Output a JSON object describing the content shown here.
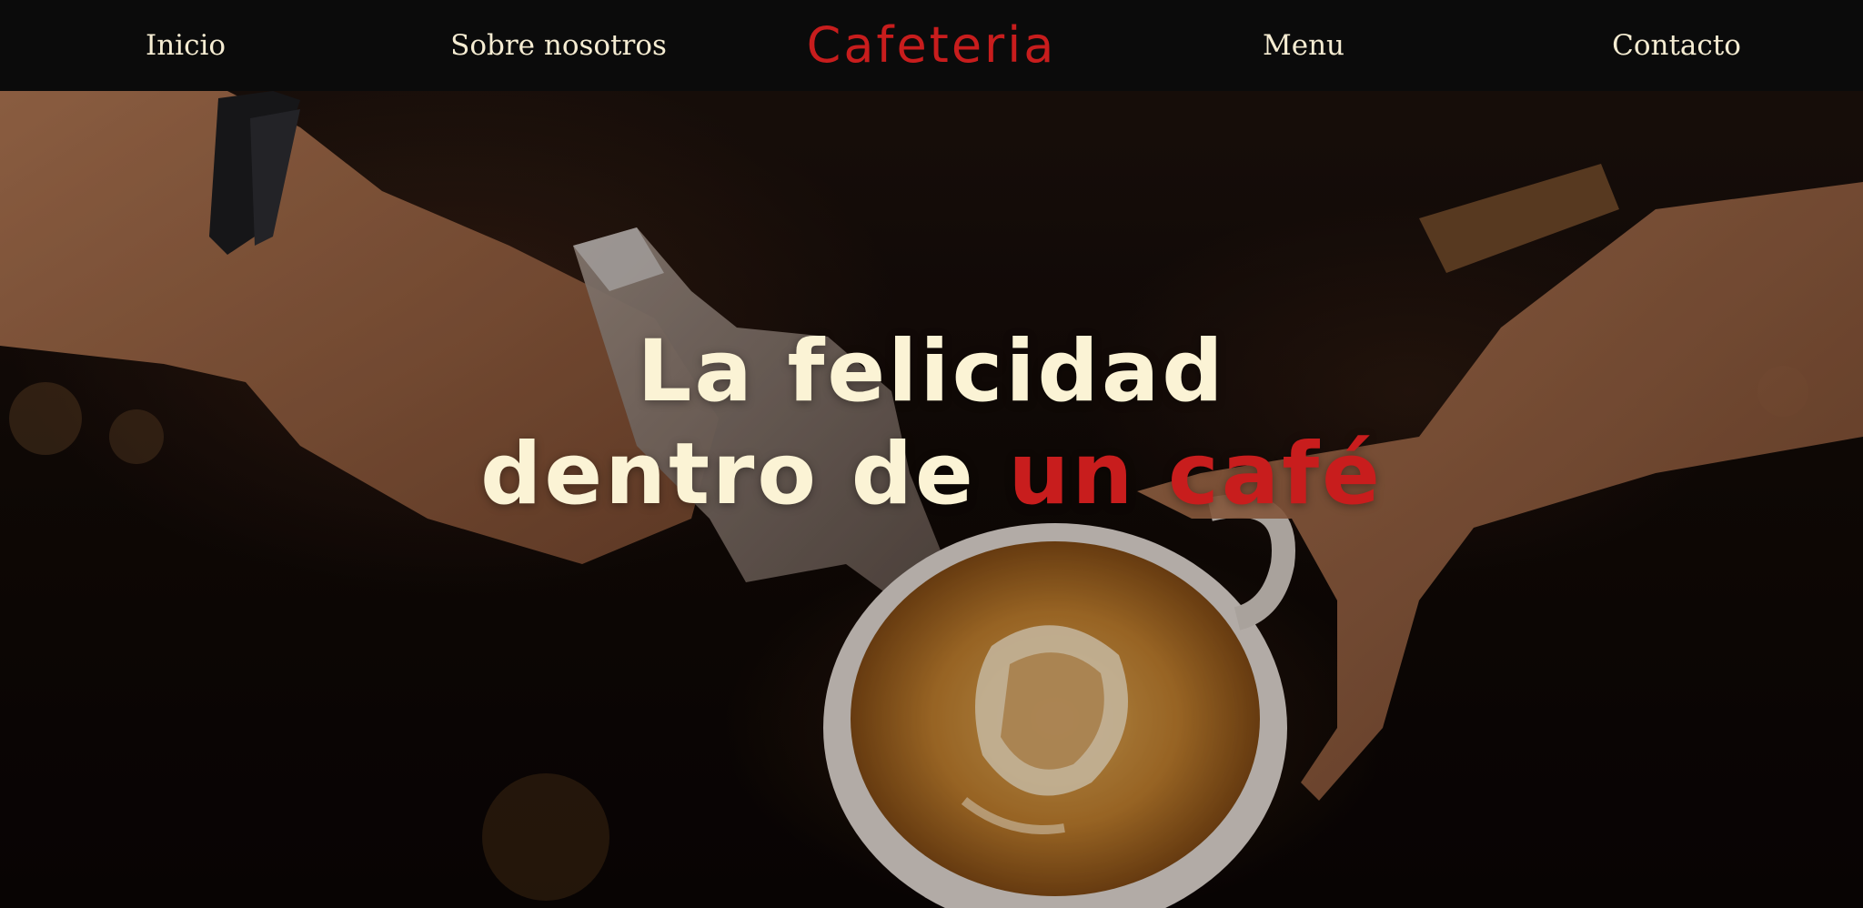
{
  "nav": {
    "left_links": [
      "Inicio",
      "Sobre nosotros"
    ],
    "brand": "Cafeteria",
    "right_links": [
      "Menu",
      "Contacto"
    ]
  },
  "hero": {
    "headline_line1": "La felicidad",
    "headline_line2_part1": "dentro de",
    "headline_line2_accent": "un café",
    "background_image": "barista-pouring-latte-art-image"
  },
  "colors": {
    "nav_background": "#0b0b0b",
    "nav_text": "#f5ecd2",
    "accent": "#c81d1d",
    "headline_text": "#fbf3d5"
  }
}
